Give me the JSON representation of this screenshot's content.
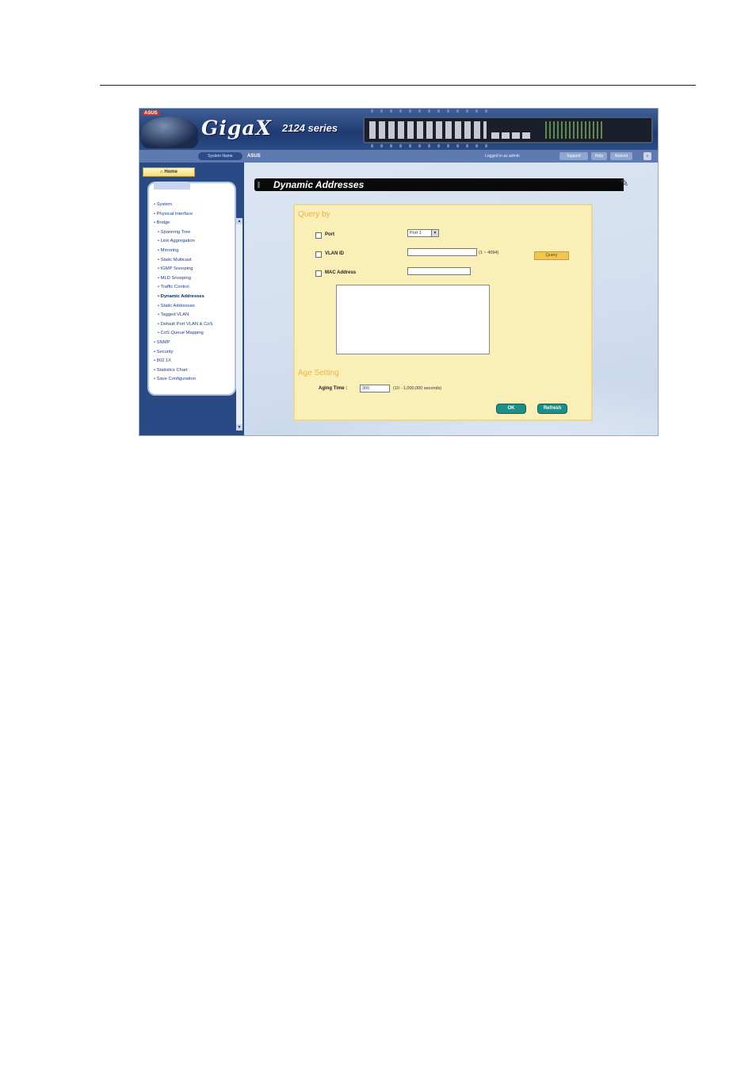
{
  "header": {
    "brand_tag": "ASUS",
    "logo_text": "GigaX",
    "series_text": "2124 series"
  },
  "topbar": {
    "system_name_label": "System Name",
    "system_name": "ASUS",
    "logged_in": "Logged in as admin",
    "buttons": [
      "Support",
      "Help",
      "Reboot",
      "»"
    ]
  },
  "nav": {
    "home_label": "Home",
    "items": [
      {
        "label": "System",
        "sub": false
      },
      {
        "label": "Physical Interface",
        "sub": false
      },
      {
        "label": "Bridge",
        "sub": false
      },
      {
        "label": "Spanning Tree",
        "sub": true
      },
      {
        "label": "Link Aggregation",
        "sub": true
      },
      {
        "label": "Mirroring",
        "sub": true
      },
      {
        "label": "Static Multicast",
        "sub": true
      },
      {
        "label": "IGMP Snooping",
        "sub": true
      },
      {
        "label": "MLD Snooping",
        "sub": true
      },
      {
        "label": "Traffic Control",
        "sub": true
      },
      {
        "label": "Dynamic Addresses",
        "sub": true
      },
      {
        "label": "Static Addresses",
        "sub": true
      },
      {
        "label": "Tagged VLAN",
        "sub": true
      },
      {
        "label": "Default Port VLAN & CoS",
        "sub": true
      },
      {
        "label": "CoS Queue Mapping",
        "sub": true
      },
      {
        "label": "SNMP",
        "sub": false
      },
      {
        "label": "Security",
        "sub": false
      },
      {
        "label": "802.1X",
        "sub": false
      },
      {
        "label": "Statistics Chart",
        "sub": false
      },
      {
        "label": "Save Configuration",
        "sub": false
      }
    ],
    "active_index": 10
  },
  "page": {
    "title": "Dynamic Addresses",
    "query_by_title": "Query by",
    "port_label": "Port",
    "port_value": "Port 1",
    "vlanid_label": "VLAN ID",
    "vlanid_value": "",
    "vlanid_hint": "(1 ~ 4094)",
    "mac_label": "MAC Address",
    "mac_value": "",
    "query_button": "Query",
    "age_title": "Age Setting",
    "aging_label": "Aging Time :",
    "aging_value": "300",
    "aging_hint": "(10 - 1,000,000 seconds)",
    "ok_button": "OK",
    "refresh_button": "Refresh"
  },
  "colors": {
    "banner": "#1e3a70",
    "panel": "#fbefb8",
    "section_title": "#e7b54a",
    "action_button": "#1d8f8a",
    "query_button": "#f1c550"
  }
}
